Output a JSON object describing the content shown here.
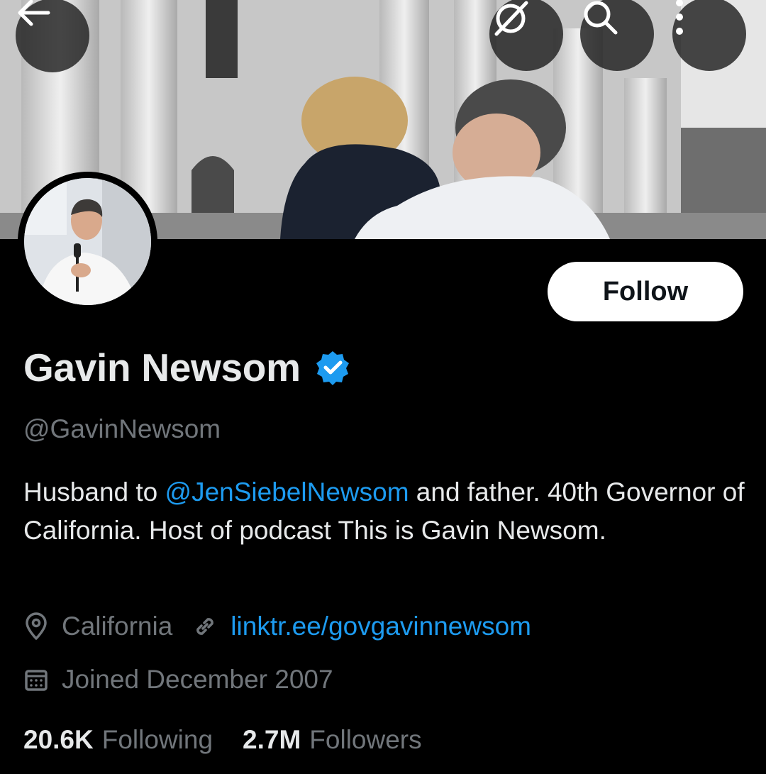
{
  "header": {
    "back_icon": "arrow-left-icon",
    "grok_icon": "grok-slash-icon",
    "search_icon": "search-icon",
    "more_icon": "vertical-ellipsis-icon"
  },
  "profile": {
    "display_name": "Gavin Newsom",
    "handle": "@GavinNewsom",
    "follow_label": "Follow",
    "bio": {
      "prefix": "Husband to ",
      "mention": "@JenSiebelNewsom",
      "suffix": " and father. 40th Governor of California. Host of podcast This is Gavin Newsom."
    },
    "location": "California",
    "website": "linktr.ee/govgavinnewsom",
    "joined": "Joined December 2007",
    "following_count": "20.6K",
    "following_label": "Following",
    "followers_count": "2.7M",
    "followers_label": "Followers"
  },
  "colors": {
    "background": "#000000",
    "text_primary": "#e7e9ea",
    "text_secondary": "#71767b",
    "accent": "#1d9bf0",
    "follow_bg": "#ffffff"
  }
}
